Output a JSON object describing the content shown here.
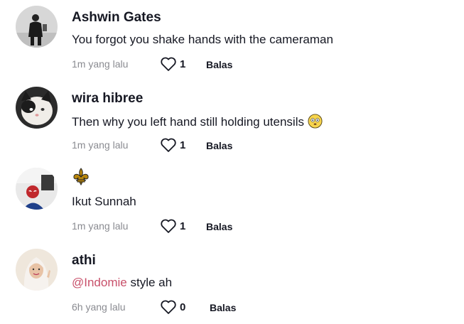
{
  "comments": [
    {
      "username": "Ashwin Gates",
      "text": "You forgot you shake hands with the cameraman",
      "time": "1m yang lalu",
      "likes": "1",
      "reply_label": "Balas",
      "avatar_icon": "person-photo-avatar"
    },
    {
      "username": "wira hibree",
      "text": "Then why you left hand still holding utensils",
      "emoji_icon": "flushed-face-emoji",
      "time": "1m yang lalu",
      "likes": "1",
      "reply_label": "Balas",
      "avatar_icon": "cat-photo-avatar"
    },
    {
      "username_icon": "fleur-de-lis-emblem",
      "text": "Ikut Sunnah",
      "time": "1m yang lalu",
      "likes": "1",
      "reply_label": "Balas",
      "avatar_icon": "spiderman-photo-avatar"
    },
    {
      "username": "athi",
      "mention": "@Indomie",
      "text": " style ah",
      "time": "6h yang lalu",
      "likes": "0",
      "reply_label": "Balas",
      "avatar_icon": "hijab-girl-photo-avatar"
    }
  ],
  "colors": {
    "text": "#161823",
    "muted": "#8a8b91",
    "mention": "#c8506a",
    "emblem": "#b8860b"
  }
}
